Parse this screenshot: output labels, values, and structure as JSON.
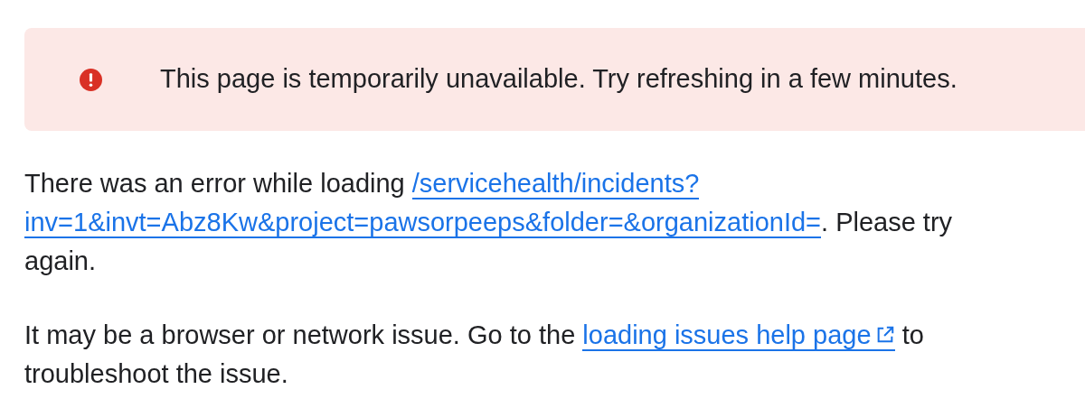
{
  "alert": {
    "kind": "error",
    "message": "This page is temporarily unavailable. Try refreshing in a few minutes."
  },
  "error_paragraph": {
    "before": "There was an error while loading ",
    "link_lines": [
      "/servicehealth/incidents?",
      "inv=1&invt=Abz8Kw&project=pawsorpeeps&folder=&organizationId="
    ],
    "after": ". Please try again."
  },
  "help_paragraph": {
    "before": "It may be a browser or network issue. Go to the ",
    "link": "loading issues help page",
    "after": " to troubleshoot the issue."
  }
}
